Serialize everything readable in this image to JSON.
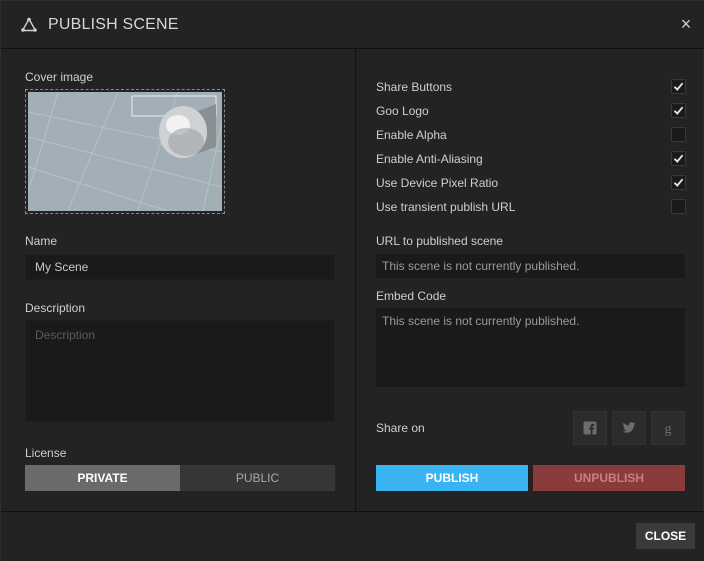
{
  "header": {
    "title": "PUBLISH SCENE",
    "close_symbol": "×"
  },
  "left": {
    "cover_label": "Cover image",
    "name_label": "Name",
    "name_value": "My Scene",
    "description_label": "Description",
    "description_placeholder": "Description",
    "license_label": "License",
    "license_options": [
      "PRIVATE",
      "PUBLIC"
    ],
    "license_selected": "PRIVATE"
  },
  "right": {
    "options": [
      {
        "label": "Share Buttons",
        "checked": true
      },
      {
        "label": "Goo Logo",
        "checked": true
      },
      {
        "label": "Enable Alpha",
        "checked": false
      },
      {
        "label": "Enable Anti-Aliasing",
        "checked": true
      },
      {
        "label": "Use Device Pixel Ratio",
        "checked": true
      },
      {
        "label": "Use transient publish URL",
        "checked": false
      }
    ],
    "url_label": "URL to published scene",
    "url_value": "This scene is not currently published.",
    "embed_label": "Embed Code",
    "embed_value": "This scene is not currently published.",
    "share_label": "Share on",
    "share_icons": [
      "facebook-icon",
      "twitter-icon",
      "google-plus-icon"
    ],
    "publish_label": "PUBLISH",
    "unpublish_label": "UNPUBLISH"
  },
  "footer": {
    "close_label": "CLOSE"
  },
  "colors": {
    "publish": "#39b3f2",
    "unpublish": "#8a3b3b",
    "license_active": "#6a6a6a"
  }
}
